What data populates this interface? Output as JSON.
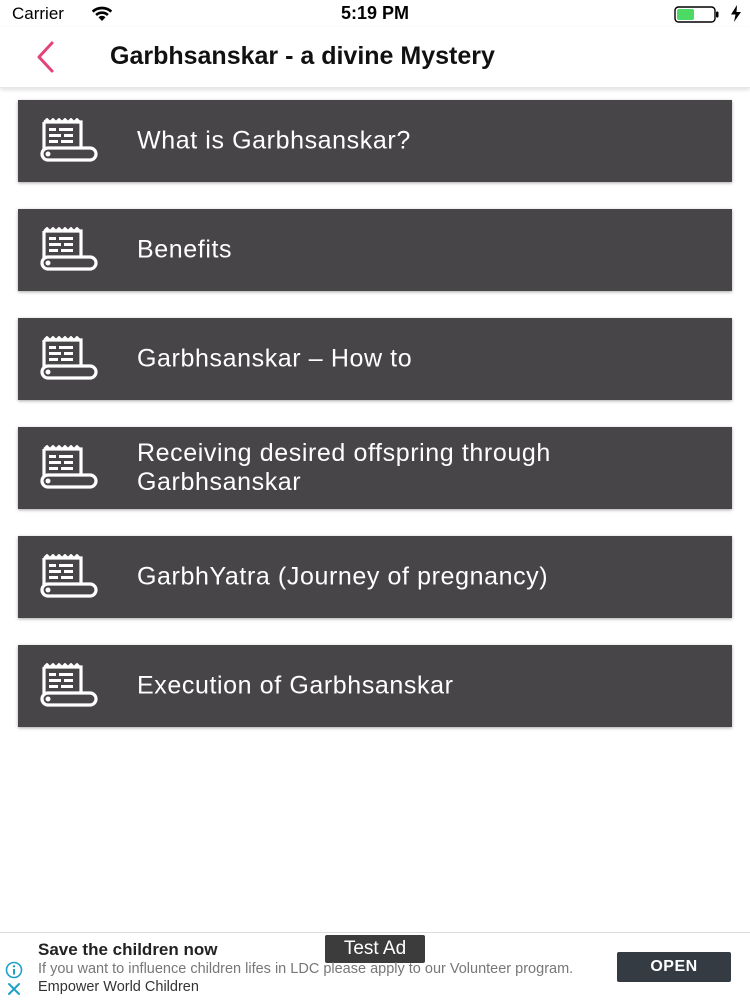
{
  "status_bar": {
    "carrier": "Carrier",
    "time": "5:19 PM",
    "icons": [
      "wifi-icon",
      "battery-icon",
      "charging-bolt-icon"
    ],
    "battery_color": "#4cd964"
  },
  "nav": {
    "title": "Garbhsanskar - a divine Mystery",
    "back_icon": "chevron-left-icon",
    "accent_color": "#e4437a"
  },
  "menu": {
    "item_icon": "scroll-document-icon",
    "background_color": "#474548",
    "items": [
      {
        "label": "What is Garbhsanskar?"
      },
      {
        "label": "Benefits"
      },
      {
        "label": "Garbhsanskar – How to"
      },
      {
        "label": "Receiving desired offspring through Garbhsanskar"
      },
      {
        "label": "GarbhYatra (Journey of pregnancy)"
      },
      {
        "label": "Execution of Garbhsanskar"
      }
    ]
  },
  "ad": {
    "headline": "Save the children now",
    "tag": "Test Ad",
    "body": "If you want to influence children lifes in LDC please apply to our Volunteer program.",
    "brand": "Empower World Children",
    "cta": "OPEN",
    "icons": [
      "info-icon",
      "close-icon"
    ]
  }
}
